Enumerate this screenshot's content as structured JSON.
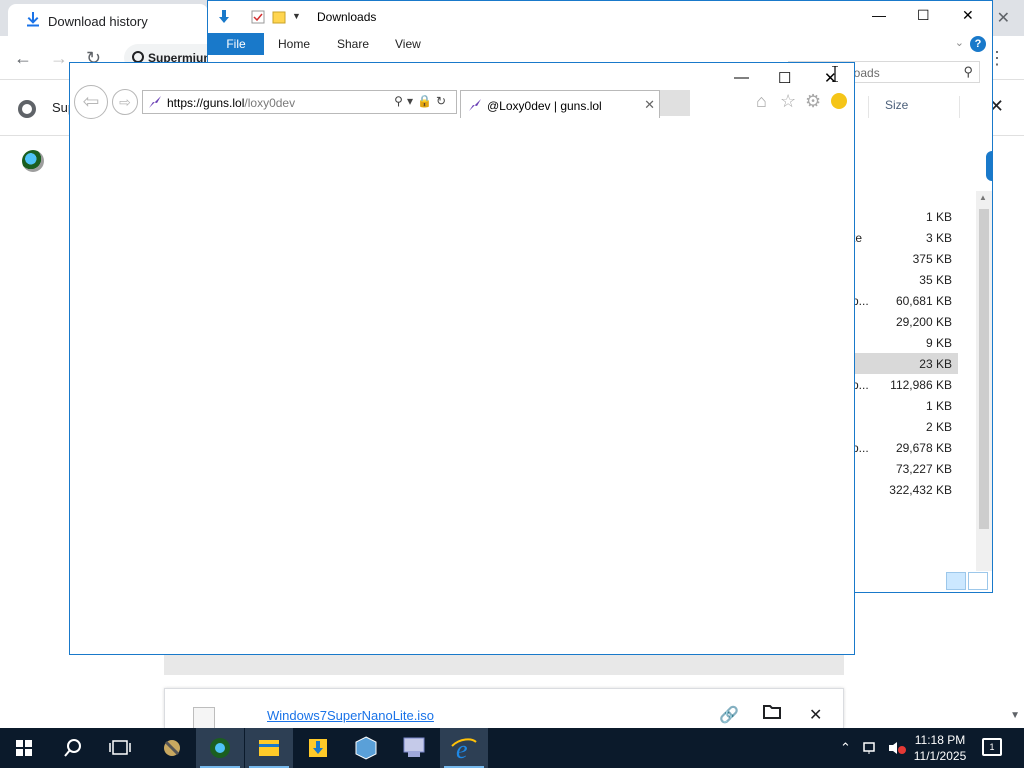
{
  "chrome": {
    "tab_title": "Download history",
    "omnibox_site": "Supermium",
    "subbar_text": "Sup",
    "download_item": {
      "filename": "Windows7SuperNanoLite.iso"
    }
  },
  "explorer": {
    "title": "Downloads",
    "ribbon_tabs": [
      "File",
      "Home",
      "Share",
      "View"
    ],
    "search_placeholder": "loads",
    "size_header": "Size",
    "rows": [
      {
        "frag": "",
        "size": "1 KB"
      },
      {
        "frag": "te",
        "size": "3 KB"
      },
      {
        "frag": "",
        "size": "375 KB"
      },
      {
        "frag": "",
        "size": "35 KB"
      },
      {
        "frag": "p...",
        "size": "60,681 KB"
      },
      {
        "frag": "",
        "size": "29,200 KB"
      },
      {
        "frag": "",
        "size": "9 KB"
      },
      {
        "frag": "",
        "size": "23 KB",
        "selected": true
      },
      {
        "frag": "p...",
        "size": "112,986 KB"
      },
      {
        "frag": "",
        "size": "1 KB"
      },
      {
        "frag": "",
        "size": "2 KB"
      },
      {
        "frag": "p...",
        "size": "29,678 KB"
      },
      {
        "frag": "",
        "size": "73,227 KB"
      },
      {
        "frag": "",
        "size": "322,432 KB"
      }
    ]
  },
  "ie": {
    "url_host": "https://guns.lol",
    "url_path": "/loxy0dev",
    "tab_title": "@Loxy0dev | guns.lol"
  },
  "taskbar": {
    "time": "11:18 PM",
    "date": "11/1/2025",
    "notifications": "1"
  },
  "colors": {
    "accent": "#1979ca",
    "taskbar": "#0b1a2b"
  }
}
